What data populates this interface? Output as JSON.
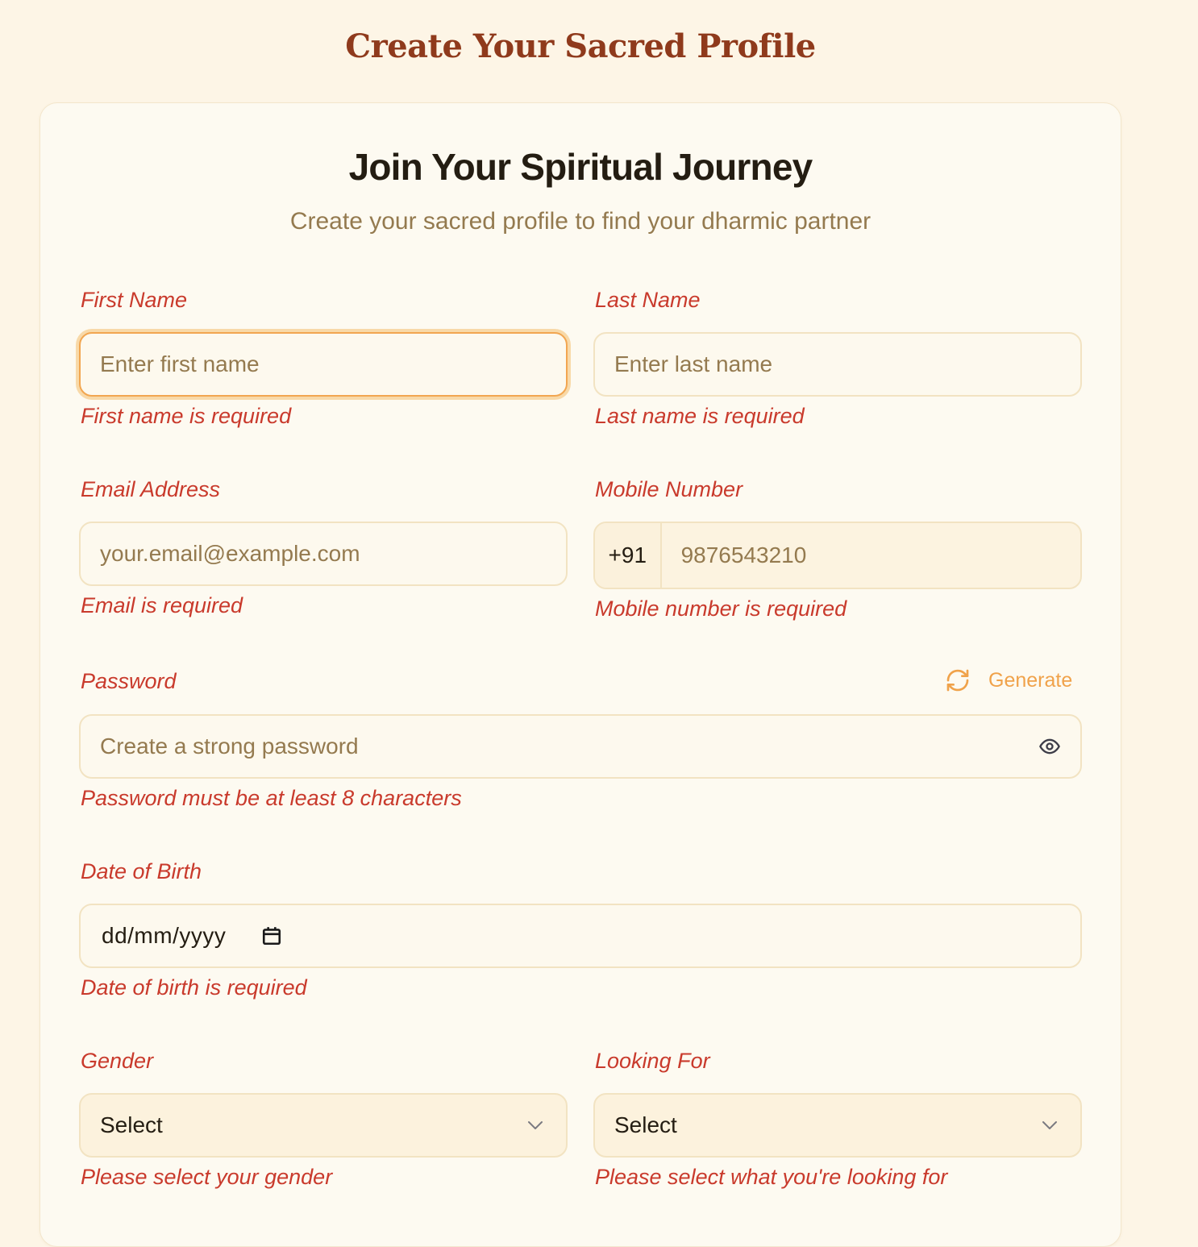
{
  "header": {
    "title": "Create Your Sacred Profile"
  },
  "card": {
    "title": "Join Your Spiritual Journey",
    "subtitle": "Create your sacred profile to find your dharmic partner"
  },
  "form": {
    "first_name": {
      "label": "First Name",
      "placeholder": "Enter first name",
      "error": "First name is required"
    },
    "last_name": {
      "label": "Last Name",
      "placeholder": "Enter last name",
      "error": "Last name is required"
    },
    "email": {
      "label": "Email Address",
      "placeholder": "your.email@example.com",
      "error": "Email is required"
    },
    "mobile": {
      "label": "Mobile Number",
      "country_code": "+91",
      "placeholder": "9876543210",
      "error": "Mobile number is required"
    },
    "password": {
      "label": "Password",
      "generate_label": "Generate",
      "placeholder": "Create a strong password",
      "error": "Password must be at least 8 characters",
      "toggle_icon": "eye-icon"
    },
    "dob": {
      "label": "Date of Birth",
      "value_format": "dd/mm/yyyy",
      "error": "Date of birth is required",
      "icon": "calendar-icon"
    },
    "gender": {
      "label": "Gender",
      "selected": "Select",
      "error": "Please select your gender"
    },
    "looking_for": {
      "label": "Looking For",
      "selected": "Select",
      "error": "Please select what you're looking for"
    }
  },
  "colors": {
    "background": "#fdf5e6",
    "title": "#8f3a1c",
    "error": "#c93a2c",
    "accent": "#f0a24a",
    "focus_ring": "#f2a650"
  }
}
